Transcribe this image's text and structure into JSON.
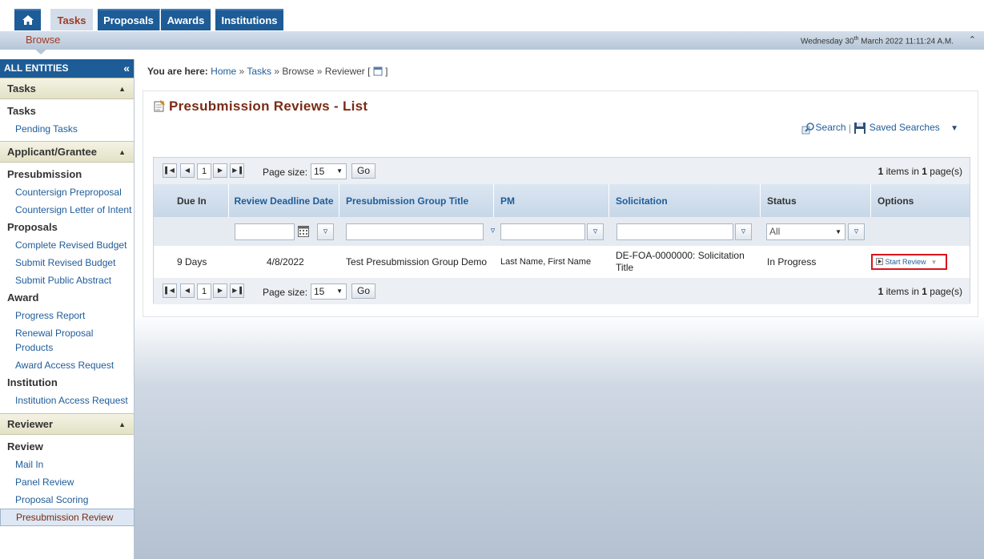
{
  "nav": {
    "tabs": [
      {
        "label": "Tasks"
      },
      {
        "label": "Proposals"
      },
      {
        "label": "Awards"
      },
      {
        "label": "Institutions"
      }
    ],
    "sub_tab": "Browse",
    "date_prefix": "Wednesday 30",
    "date_sup": "th",
    "date_suffix": " March 2022 11:11:24 A.M."
  },
  "sidebar": {
    "title": "ALL ENTITIES",
    "sections": [
      {
        "title": "Tasks",
        "groups": [
          {
            "label": "Tasks",
            "links": [
              "Pending Tasks"
            ]
          }
        ]
      },
      {
        "title": "Applicant/Grantee",
        "groups": [
          {
            "label": "Presubmission",
            "links": [
              "Countersign Preproposal",
              "Countersign Letter of Intent"
            ]
          },
          {
            "label": "Proposals",
            "links": [
              "Complete Revised Budget",
              "Submit Revised Budget",
              "Submit Public Abstract"
            ]
          },
          {
            "label": "Award",
            "links": [
              "Progress Report",
              "Renewal Proposal Products",
              "Award Access Request"
            ]
          },
          {
            "label": "Institution",
            "links": [
              "Institution Access Request"
            ]
          }
        ]
      },
      {
        "title": "Reviewer",
        "groups": [
          {
            "label": "Review",
            "links": [
              "Mail In",
              "Panel Review",
              "Proposal Scoring",
              "Presubmission Review"
            ]
          }
        ]
      }
    ]
  },
  "breadcrumb": {
    "prefix": "You are here:",
    "items": [
      "Home",
      "Tasks",
      "Browse",
      "Reviewer ["
    ],
    "suffix": "]"
  },
  "page": {
    "title": "Presubmission Reviews - List",
    "search_label": "Search",
    "saved_searches_label": "Saved Searches"
  },
  "grid": {
    "page_number": "1",
    "page_size_label": "Page size:",
    "page_size": "15",
    "go_label": "Go",
    "items_count": "1",
    "items_text": " items in ",
    "pages_count": "1",
    "pages_text": " page(s)",
    "columns": [
      "Due In",
      "Review Deadline Date",
      "Presubmission Group Title",
      "PM",
      "Solicitation",
      "Status",
      "Options"
    ],
    "status_filter": "All",
    "rows": [
      {
        "due_in": "9 Days",
        "deadline": "4/8/2022",
        "group_title": "Test Presubmission Group Demo",
        "pm": "Last Name, First Name",
        "solicitation": "DE-FOA-0000000: Solicitation Title",
        "status": "In Progress",
        "option": "Start Review"
      }
    ]
  }
}
